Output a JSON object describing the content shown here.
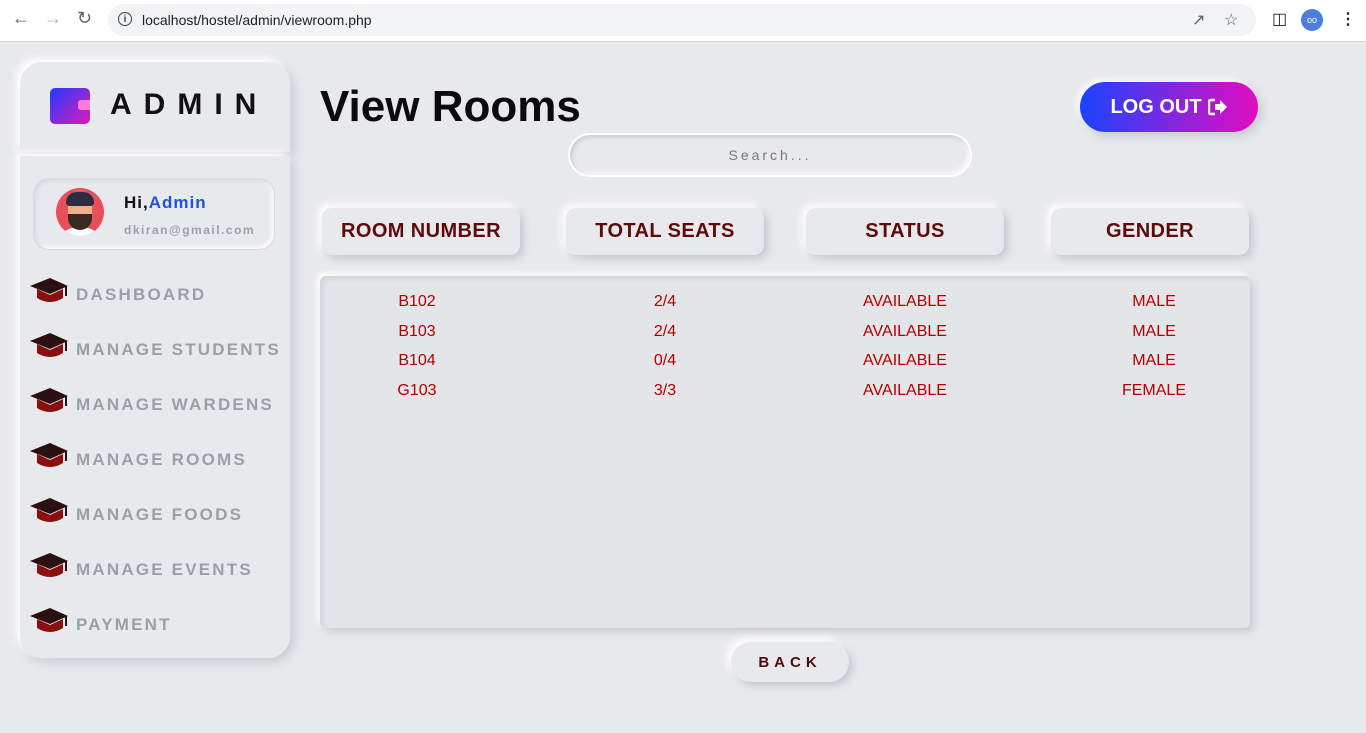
{
  "browser": {
    "url": "localhost/hostel/admin/viewroom.php"
  },
  "sidebar": {
    "logo_text": "ADMIN",
    "greeting": "Hi,",
    "user_name": "Admin",
    "email": "dkiran@gmail.com",
    "items": [
      {
        "label": "DASHBOARD"
      },
      {
        "label": "MANAGE STUDENTS"
      },
      {
        "label": "MANAGE WARDENS"
      },
      {
        "label": "MANAGE ROOMS"
      },
      {
        "label": "MANAGE FOODS"
      },
      {
        "label": "MANAGE EVENTS"
      },
      {
        "label": "PAYMENT"
      }
    ]
  },
  "header": {
    "title": "View Rooms",
    "logout_label": "LOG OUT"
  },
  "search": {
    "placeholder": "Search..."
  },
  "table": {
    "columns": [
      "ROOM NUMBER",
      "TOTAL SEATS",
      "STATUS",
      "GENDER"
    ],
    "rows": [
      [
        "B102",
        "2/4",
        "AVAILABLE",
        "MALE"
      ],
      [
        "B103",
        "2/4",
        "AVAILABLE",
        "MALE"
      ],
      [
        "B104",
        "0/4",
        "AVAILABLE",
        "MALE"
      ],
      [
        "G103",
        "3/3",
        "AVAILABLE",
        "FEMALE"
      ]
    ]
  },
  "footer": {
    "back_label": "BACK"
  },
  "colors": {
    "accent_start": "#1844ff",
    "accent_end": "#e40cc0",
    "cell_text": "#b30000",
    "header_text": "#5c0a0a"
  }
}
